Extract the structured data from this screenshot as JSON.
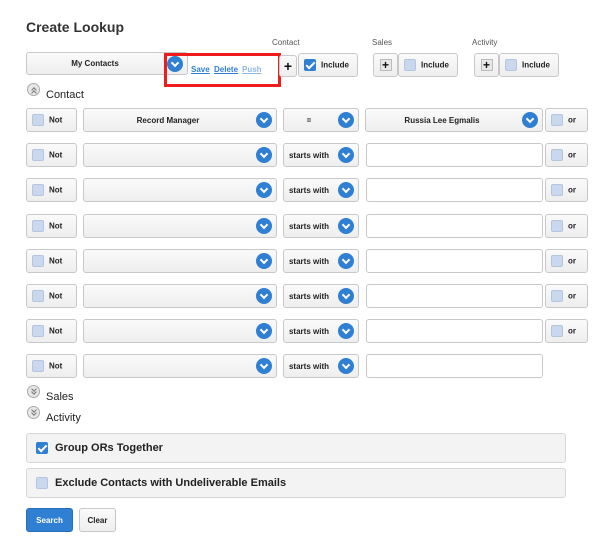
{
  "title": "Create Lookup",
  "header": {
    "saved_lookup": "My Contacts",
    "links": {
      "save": "Save",
      "delete": "Delete",
      "push": "Push"
    },
    "groups": [
      {
        "label": "Contact",
        "include_label": "Include",
        "checked": true
      },
      {
        "label": "Sales",
        "include_label": "Include",
        "checked": false
      },
      {
        "label": "Activity",
        "include_label": "Include",
        "checked": false
      }
    ]
  },
  "sections": {
    "contact": "Contact",
    "sales": "Sales",
    "activity": "Activity"
  },
  "criteria": {
    "not_label": "Not",
    "or_label": "or",
    "rows": [
      {
        "field": "Record Manager",
        "operator": "=",
        "value": "Russia Lee Egmalis",
        "value_is_dropdown": true,
        "has_or": true
      },
      {
        "field": "",
        "operator": "starts with",
        "value": "",
        "has_or": true
      },
      {
        "field": "",
        "operator": "starts with",
        "value": "",
        "has_or": true
      },
      {
        "field": "",
        "operator": "starts with",
        "value": "",
        "has_or": true
      },
      {
        "field": "",
        "operator": "starts with",
        "value": "",
        "has_or": true
      },
      {
        "field": "",
        "operator": "starts with",
        "value": "",
        "has_or": true
      },
      {
        "field": "",
        "operator": "starts with",
        "value": "",
        "has_or": true
      },
      {
        "field": "",
        "operator": "starts with",
        "value": "",
        "has_or": false
      }
    ]
  },
  "options": {
    "group_ors": {
      "label": "Group ORs Together",
      "checked": true
    },
    "exclude_undeliverable": {
      "label": "Exclude Contacts with Undeliverable Emails",
      "checked": false
    }
  },
  "buttons": {
    "search": "Search",
    "clear": "Clear"
  },
  "colors": {
    "accent": "#2f7fd3",
    "highlight_box": "#ee1c1c"
  }
}
